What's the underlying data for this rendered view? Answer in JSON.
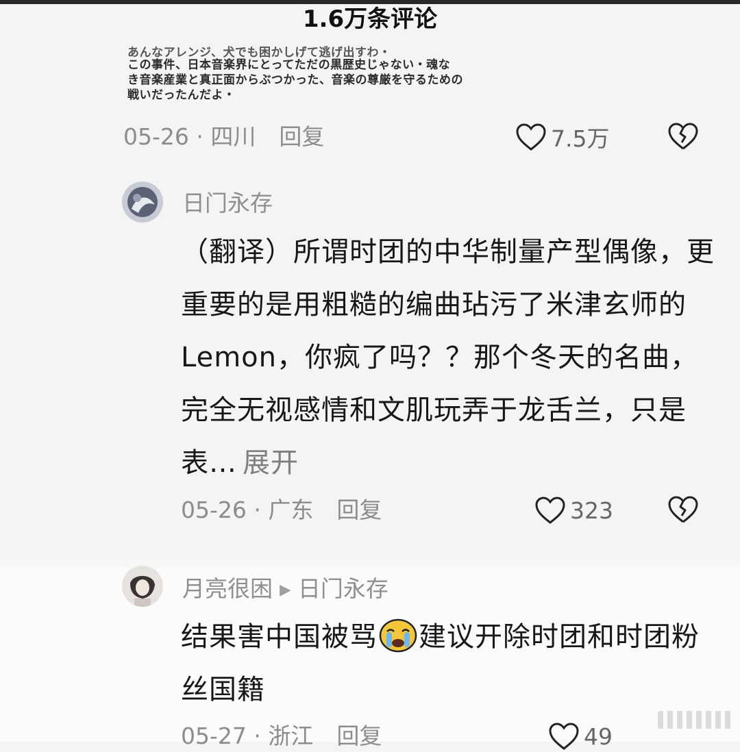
{
  "header": {
    "title": "1.6万条评论"
  },
  "top_comment": {
    "jp_lines": [
      "あんなアレンジ、犬でも困かしげて逃げ出すわ・",
      "この事件、日本音楽界にとってただの黒歴史じゃない・魂な",
      "き音楽産業と真正面からぶつかった、音楽の尊厳を守るための",
      "戦いだったんだよ・"
    ],
    "date_location": "05-26 · 四川",
    "reply_label": "回复",
    "likes": "7.5万"
  },
  "comment1": {
    "username": "日门永存",
    "text": "（翻译）所谓时团的中华制量产型偶像，更重要的是用粗糙的编曲玷污了米津玄师的Lemon，你疯了吗？？那个冬天的名曲，完全无视感情和文肌玩弄于龙舌兰，只是表…",
    "expand_label": "展开",
    "date_location": "05-26 · 广东",
    "reply_label": "回复",
    "likes": "323"
  },
  "comment2": {
    "username": "月亮很困",
    "reply_to": "日门永存",
    "text_part1": "结果害中国被骂",
    "emoji": "crying-face",
    "text_part2": "建议开除时团和时团粉丝国籍",
    "date_location": "05-27 · 浙江",
    "reply_label": "回复",
    "likes": "49"
  },
  "colors": {
    "background": "#f4f4f3",
    "meta_text": "#8c8c8c",
    "body_text": "#171717"
  }
}
